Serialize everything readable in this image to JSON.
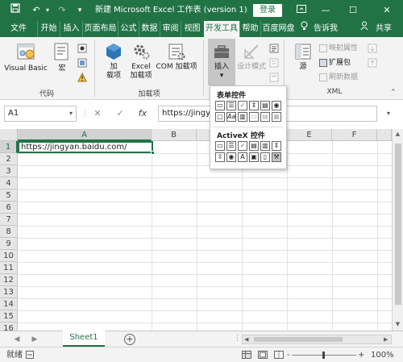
{
  "titlebar": {
    "save_icon": "save-icon",
    "undo_icon": "undo-icon",
    "redo_icon": "redo-icon",
    "customize_icon": "customize-quick-access-icon",
    "title": "新建 Microsoft Excel 工作表 (version 1).x...",
    "login_label": "登录",
    "window_controls": [
      "ribbon-options-icon",
      "minimize-icon",
      "maximize-icon",
      "close-icon"
    ]
  },
  "tabs": {
    "items": [
      "文件",
      "开始",
      "插入",
      "页面布局",
      "公式",
      "数据",
      "审阅",
      "视图",
      "开发工具",
      "帮助",
      "百度网盘"
    ],
    "active": "开发工具",
    "tell_me": "告诉我",
    "share": "共享"
  },
  "ribbon": {
    "code": {
      "label": "代码",
      "visual_basic": "Visual Basic",
      "macro": "宏"
    },
    "addins": {
      "label": "加载项",
      "addin_line1": "加",
      "addin_line2": "载项",
      "excel_addin_line1": "Excel",
      "excel_addin_line2": "加载项",
      "com_addin": "COM 加载项"
    },
    "controls": {
      "insert": "插入",
      "design_mode": "设计模式"
    },
    "xml": {
      "label": "XML",
      "source": "源",
      "map_properties": "映射属性",
      "expansion_packs": "扩展包",
      "refresh_data": "刷新数据"
    }
  },
  "formula_bar": {
    "name_box": "A1",
    "cancel": "✕",
    "enter": "✓",
    "fx": "fx",
    "value": "https://jingyan.baidu.com/"
  },
  "grid": {
    "columns": [
      "A",
      "B",
      "C",
      "D",
      "E",
      "F"
    ],
    "rows": [
      "1",
      "2",
      "3",
      "4",
      "5",
      "6",
      "7",
      "8",
      "9",
      "10",
      "11",
      "12",
      "13",
      "14",
      "15",
      "16"
    ],
    "a1_value": "https://jingyan.baidu.com/"
  },
  "dropdown": {
    "form_controls_title": "表单控件",
    "activex_title": "ActiveX 控件"
  },
  "sheets": {
    "tabs": [
      "Sheet1"
    ],
    "add": "⊕"
  },
  "statusbar": {
    "ready": "就绪",
    "zoom_minus": "-",
    "zoom_plus": "+",
    "zoom_level": "100%"
  }
}
